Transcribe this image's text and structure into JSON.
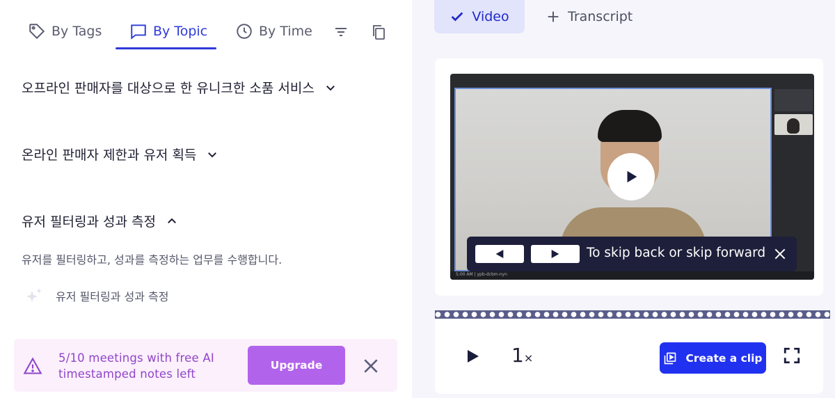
{
  "left_tabs": {
    "by_tags": "By Tags",
    "by_topic": "By Topic",
    "by_time": "By Time"
  },
  "topics": [
    {
      "title": "오프라인 판매자를 대상으로 한 유니크한 소품 서비스",
      "expanded": false
    },
    {
      "title": "온라인 판매자 제한과 유저 획득",
      "expanded": false
    },
    {
      "title": "유저 필터링과 성과 측정",
      "expanded": true,
      "description": "유저를 필터링하고, 성과를 측정하는 업무를 수행합니다.",
      "subtopic": "유저 필터링과 성과 측정"
    }
  ],
  "banner": {
    "text": "5/10 meetings with free AI timestamped notes left",
    "upgrade_label": "Upgrade"
  },
  "right_tabs": {
    "video": "Video",
    "transcript": "Transcript"
  },
  "video": {
    "footer_time": "5:00 AM  |  ypb-dcbm-nyn",
    "skip_hint": "To skip back or skip forward"
  },
  "controls": {
    "speed_value": "1",
    "speed_suffix": "×",
    "create_clip_label": "Create a clip"
  },
  "colors": {
    "accent": "#2f3ad9",
    "clip_button": "#2131f0",
    "upgrade": "#b263eb",
    "banner_bg": "#fbf0fc",
    "banner_text": "#9145c9"
  }
}
